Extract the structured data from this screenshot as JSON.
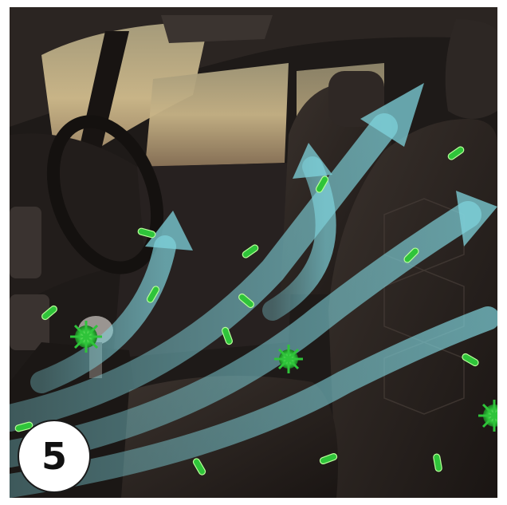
{
  "image": {
    "subject": "car-interior-cabin-air-flow-illustration",
    "colors": {
      "airflow": "#7fd3dc",
      "germ": "#2fc43a",
      "germ_highlight": "#b8ff9a",
      "leather": "#2a2421",
      "window_light": "#c8b487"
    }
  },
  "badge": {
    "number": "5"
  }
}
